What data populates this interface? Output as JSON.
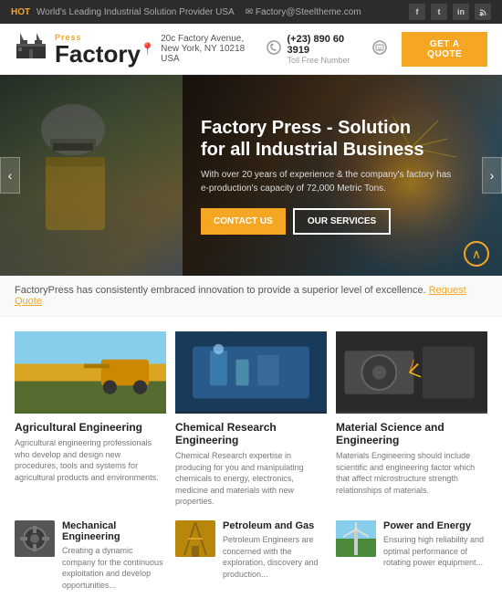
{
  "topbar": {
    "tag": "HOT",
    "announcement": "World's Leading Industrial Solution Provider USA",
    "email": "Factory@Steeltheme.com",
    "socials": [
      "f",
      "t",
      "in",
      "🔒"
    ]
  },
  "header": {
    "logo_press": "Press",
    "logo_factory": "Factory",
    "address_icon": "📍",
    "address_line1": "20c Factory Avenue,",
    "address_line2": "New York, NY 10218 USA",
    "phone_icon": "📞",
    "phone_number": "(+23) 890 60 3919",
    "phone_label": "Toll Free Number",
    "fax_icon": "📠",
    "quote_btn": "GET A QUOTE"
  },
  "hero": {
    "title": "Factory Press - Solution\nfor all Industrial Business",
    "subtitle": "With over 20 years of experience & the company's factory has e-production's capacity of 72,000 Metric Tons.",
    "btn_contact": "CONTACT US",
    "btn_services": "OUR SERVICES",
    "arrow_left": "‹",
    "arrow_right": "›",
    "scroll_up": "∧"
  },
  "banner": {
    "text": "FactoryPress has consistently embraced innovation to provide a superior level of excellence.",
    "link_text": "Request Quote"
  },
  "services": {
    "top": [
      {
        "name": "Agricultural Engineering",
        "desc": "Agricultural engineering professionals who develop and design new procedures, tools and systems for agricultural products and environments."
      },
      {
        "name": "Chemical Research Engineering",
        "desc": "Chemical Research expertise in producing for you and manipulating chemicals to energy, electronics, medicine and materials with new properties."
      },
      {
        "name": "Material Science and Engineering",
        "desc": "Materials Engineering should include scientific and engineering factor which that affect microstructure strength relationships of materials."
      }
    ],
    "bottom": [
      {
        "name": "Mechanical Engineering",
        "desc": "Creating a dynamic company for the continuous exploitation and develop opportunities..."
      },
      {
        "name": "Petroleum and Gas",
        "desc": "Petroleum Engineers are concerned with the exploration, discovery and production..."
      },
      {
        "name": "Power and Energy",
        "desc": "Ensuring high reliability and optimal performance of rotating power equipment..."
      }
    ]
  }
}
